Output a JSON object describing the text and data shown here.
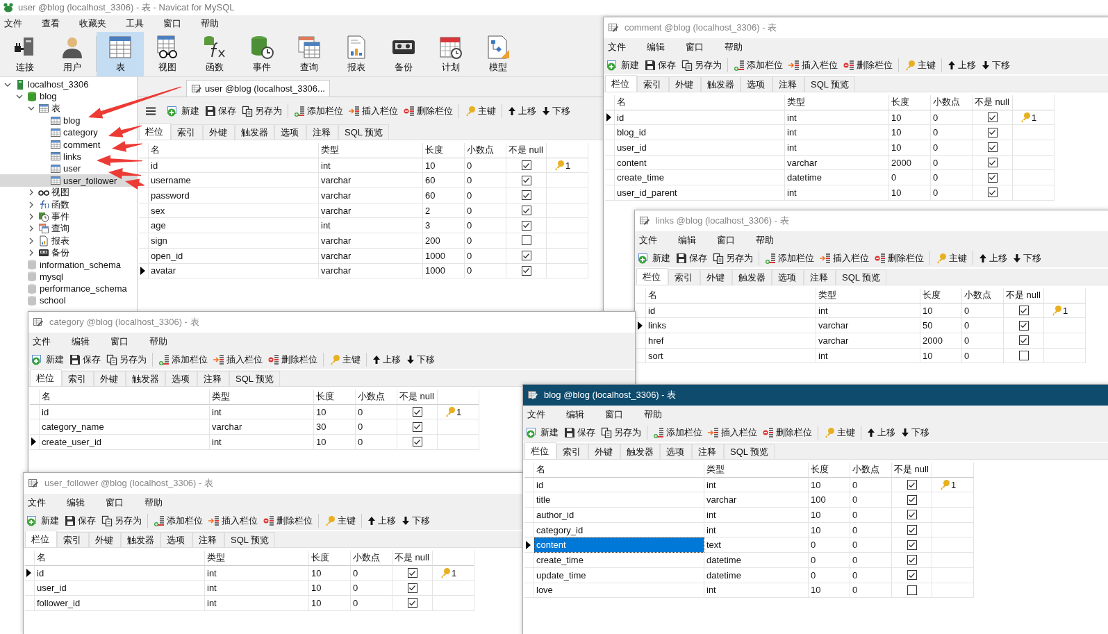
{
  "main": {
    "title": "user @blog (localhost_3306) - 表 - Navicat for MySQL",
    "menu": [
      "文件",
      "查看",
      "收藏夹",
      "工具",
      "窗口",
      "帮助"
    ],
    "ribbon": [
      {
        "kind": "connect",
        "label": "连接",
        "selected": false
      },
      {
        "kind": "user",
        "label": "用户",
        "selected": false
      },
      {
        "kind": "table",
        "label": "表",
        "selected": true
      },
      {
        "kind": "view",
        "label": "视图",
        "selected": false
      },
      {
        "kind": "function",
        "label": "函数",
        "selected": false
      },
      {
        "kind": "event",
        "label": "事件",
        "selected": false
      },
      {
        "kind": "query",
        "label": "查询",
        "selected": false
      },
      {
        "kind": "report",
        "label": "报表",
        "selected": false
      },
      {
        "kind": "backup",
        "label": "备份",
        "selected": false
      },
      {
        "kind": "schedule",
        "label": "计划",
        "selected": false
      },
      {
        "kind": "model",
        "label": "模型",
        "selected": false
      }
    ],
    "tree": [
      {
        "kind": "server",
        "label": "localhost_3306",
        "expanded": true,
        "selected": false,
        "children": [
          {
            "kind": "database",
            "label": "blog",
            "expanded": true,
            "selected": false,
            "children": [
              {
                "kind": "tables",
                "label": "表",
                "expanded": true,
                "selected": false,
                "children": [
                  {
                    "kind": "table",
                    "label": "blog",
                    "selected": false
                  },
                  {
                    "kind": "table",
                    "label": "category",
                    "selected": false
                  },
                  {
                    "kind": "table",
                    "label": "comment",
                    "selected": false
                  },
                  {
                    "kind": "table",
                    "label": "links",
                    "selected": false
                  },
                  {
                    "kind": "table",
                    "label": "user",
                    "selected": false
                  },
                  {
                    "kind": "table",
                    "label": "user_follower",
                    "selected": true
                  }
                ]
              },
              {
                "kind": "view",
                "label": "视图",
                "expanded": false,
                "selected": false
              },
              {
                "kind": "function",
                "label": "函数",
                "expanded": false,
                "selected": false
              },
              {
                "kind": "event",
                "label": "事件",
                "expanded": false,
                "selected": false
              },
              {
                "kind": "query",
                "label": "查询",
                "expanded": false,
                "selected": false
              },
              {
                "kind": "report",
                "label": "报表",
                "expanded": false,
                "selected": false
              },
              {
                "kind": "backup",
                "label": "备份",
                "expanded": false,
                "selected": false
              }
            ]
          },
          {
            "kind": "database-closed",
            "label": "information_schema",
            "selected": false
          },
          {
            "kind": "database-closed",
            "label": "mysql",
            "selected": false
          },
          {
            "kind": "database-closed",
            "label": "performance_schema",
            "selected": false
          },
          {
            "kind": "database-closed",
            "label": "school",
            "selected": false
          }
        ]
      }
    ],
    "doc_tab": "user @blog (localhost_3306..."
  },
  "windows": [
    {
      "toolbar": [
        {
          "kind": "new",
          "label": "新建"
        },
        {
          "kind": "save",
          "label": "保存"
        },
        {
          "kind": "saveas",
          "label": "另存为"
        },
        {
          "kind": "addcol",
          "label": "添加栏位"
        },
        {
          "kind": "insertcol",
          "label": "插入栏位"
        },
        {
          "kind": "delcol",
          "label": "删除栏位"
        },
        {
          "kind": "key",
          "label": "主键"
        },
        {
          "kind": "up",
          "label": "上移"
        },
        {
          "kind": "down",
          "label": "下移"
        }
      ],
      "tabs": [
        {
          "label": "栏位",
          "selected": true
        },
        {
          "label": "索引",
          "selected": false
        },
        {
          "label": "外键",
          "selected": false
        },
        {
          "label": "触发器",
          "selected": false
        },
        {
          "label": "选项",
          "selected": false
        },
        {
          "label": "注释",
          "selected": false
        },
        {
          "label": "SQL 预览",
          "selected": false
        }
      ],
      "columns": [
        "名",
        "类型",
        "长度",
        "小数点",
        "不是 null"
      ],
      "rows": [
        {
          "name": "id",
          "type": "int",
          "length": "10",
          "decimals": "0",
          "not_null": true,
          "key": "1",
          "current": false,
          "selected": false
        },
        {
          "name": "username",
          "type": "varchar",
          "length": "60",
          "decimals": "0",
          "not_null": true,
          "current": false,
          "selected": false
        },
        {
          "name": "password",
          "type": "varchar",
          "length": "60",
          "decimals": "0",
          "not_null": true,
          "current": false,
          "selected": false
        },
        {
          "name": "sex",
          "type": "varchar",
          "length": "2",
          "decimals": "0",
          "not_null": true,
          "current": false,
          "selected": false
        },
        {
          "name": "age",
          "type": "int",
          "length": "3",
          "decimals": "0",
          "not_null": true,
          "current": false,
          "selected": false
        },
        {
          "name": "sign",
          "type": "varchar",
          "length": "200",
          "decimals": "0",
          "not_null": false,
          "current": false,
          "selected": false
        },
        {
          "name": "open_id",
          "type": "varchar",
          "length": "1000",
          "decimals": "0",
          "not_null": true,
          "current": false,
          "selected": false
        },
        {
          "name": "avatar",
          "type": "varchar",
          "length": "1000",
          "decimals": "0",
          "not_null": true,
          "current": true,
          "selected": false
        }
      ]
    },
    {
      "active": false,
      "title": "comment @blog (localhost_3306) - 表",
      "menu": [
        "文件",
        "编辑",
        "窗口",
        "帮助"
      ],
      "toolbar": [
        {
          "kind": "new",
          "label": "新建"
        },
        {
          "kind": "save",
          "label": "保存"
        },
        {
          "kind": "saveas",
          "label": "另存为"
        },
        {
          "kind": "addcol",
          "label": "添加栏位"
        },
        {
          "kind": "insertcol",
          "label": "插入栏位"
        },
        {
          "kind": "delcol",
          "label": "删除栏位"
        },
        {
          "kind": "key",
          "label": "主键"
        },
        {
          "kind": "up",
          "label": "上移"
        },
        {
          "kind": "down",
          "label": "下移"
        }
      ],
      "tabs": [
        {
          "label": "栏位",
          "selected": true
        },
        {
          "label": "索引",
          "selected": false
        },
        {
          "label": "外键",
          "selected": false
        },
        {
          "label": "触发器",
          "selected": false
        },
        {
          "label": "选项",
          "selected": false
        },
        {
          "label": "注释",
          "selected": false
        },
        {
          "label": "SQL 预览",
          "selected": false
        }
      ],
      "columns": [
        "名",
        "类型",
        "长度",
        "小数点",
        "不是 null"
      ],
      "rows": [
        {
          "name": "id",
          "type": "int",
          "length": "10",
          "decimals": "0",
          "not_null": true,
          "key": "1",
          "current": true,
          "selected": false
        },
        {
          "name": "blog_id",
          "type": "int",
          "length": "10",
          "decimals": "0",
          "not_null": true,
          "current": false,
          "selected": false
        },
        {
          "name": "user_id",
          "type": "int",
          "length": "10",
          "decimals": "0",
          "not_null": true,
          "current": false,
          "selected": false
        },
        {
          "name": "content",
          "type": "varchar",
          "length": "2000",
          "decimals": "0",
          "not_null": true,
          "current": false,
          "selected": false
        },
        {
          "name": "create_time",
          "type": "datetime",
          "length": "0",
          "decimals": "0",
          "not_null": true,
          "current": false,
          "selected": false
        },
        {
          "name": "user_id_parent",
          "type": "int",
          "length": "10",
          "decimals": "0",
          "not_null": true,
          "current": false,
          "selected": false
        }
      ]
    },
    {
      "active": false,
      "title": "links @blog (localhost_3306) - 表",
      "menu": [
        "文件",
        "编辑",
        "窗口",
        "帮助"
      ],
      "toolbar": [
        {
          "kind": "new",
          "label": "新建"
        },
        {
          "kind": "save",
          "label": "保存"
        },
        {
          "kind": "saveas",
          "label": "另存为"
        },
        {
          "kind": "addcol",
          "label": "添加栏位"
        },
        {
          "kind": "insertcol",
          "label": "插入栏位"
        },
        {
          "kind": "delcol",
          "label": "删除栏位"
        },
        {
          "kind": "key",
          "label": "主键"
        },
        {
          "kind": "up",
          "label": "上移"
        },
        {
          "kind": "down",
          "label": "下移"
        }
      ],
      "tabs": [
        {
          "label": "栏位",
          "selected": true
        },
        {
          "label": "索引",
          "selected": false
        },
        {
          "label": "外键",
          "selected": false
        },
        {
          "label": "触发器",
          "selected": false
        },
        {
          "label": "选项",
          "selected": false
        },
        {
          "label": "注释",
          "selected": false
        },
        {
          "label": "SQL 预览",
          "selected": false
        }
      ],
      "columns": [
        "名",
        "类型",
        "长度",
        "小数点",
        "不是 null"
      ],
      "rows": [
        {
          "name": "id",
          "type": "int",
          "length": "10",
          "decimals": "0",
          "not_null": true,
          "key": "1",
          "current": false,
          "selected": false
        },
        {
          "name": "links",
          "type": "varchar",
          "length": "50",
          "decimals": "0",
          "not_null": true,
          "current": true,
          "selected": false
        },
        {
          "name": "href",
          "type": "varchar",
          "length": "2000",
          "decimals": "0",
          "not_null": true,
          "current": false,
          "selected": false
        },
        {
          "name": "sort",
          "type": "int",
          "length": "10",
          "decimals": "0",
          "not_null": false,
          "current": false,
          "selected": false
        }
      ]
    },
    {
      "active": false,
      "title": "category @blog (localhost_3306) - 表",
      "menu": [
        "文件",
        "编辑",
        "窗口",
        "帮助"
      ],
      "toolbar": [
        {
          "kind": "new",
          "label": "新建"
        },
        {
          "kind": "save",
          "label": "保存"
        },
        {
          "kind": "saveas",
          "label": "另存为"
        },
        {
          "kind": "addcol",
          "label": "添加栏位"
        },
        {
          "kind": "insertcol",
          "label": "插入栏位"
        },
        {
          "kind": "delcol",
          "label": "删除栏位"
        },
        {
          "kind": "key",
          "label": "主键"
        },
        {
          "kind": "up",
          "label": "上移"
        },
        {
          "kind": "down",
          "label": "下移"
        }
      ],
      "tabs": [
        {
          "label": "栏位",
          "selected": true
        },
        {
          "label": "索引",
          "selected": false
        },
        {
          "label": "外键",
          "selected": false
        },
        {
          "label": "触发器",
          "selected": false
        },
        {
          "label": "选项",
          "selected": false
        },
        {
          "label": "注释",
          "selected": false
        },
        {
          "label": "SQL 预览",
          "selected": false
        }
      ],
      "columns": [
        "名",
        "类型",
        "长度",
        "小数点",
        "不是 null"
      ],
      "rows": [
        {
          "name": "id",
          "type": "int",
          "length": "10",
          "decimals": "0",
          "not_null": true,
          "key": "1",
          "current": false,
          "selected": false
        },
        {
          "name": "category_name",
          "type": "varchar",
          "length": "30",
          "decimals": "0",
          "not_null": true,
          "current": false,
          "selected": false
        },
        {
          "name": "create_user_id",
          "type": "int",
          "length": "10",
          "decimals": "0",
          "not_null": true,
          "current": true,
          "selected": false
        }
      ]
    },
    {
      "active": false,
      "title": "user_follower @blog (localhost_3306) - 表",
      "menu": [
        "文件",
        "编辑",
        "窗口",
        "帮助"
      ],
      "toolbar": [
        {
          "kind": "new",
          "label": "新建"
        },
        {
          "kind": "save",
          "label": "保存"
        },
        {
          "kind": "saveas",
          "label": "另存为"
        },
        {
          "kind": "addcol",
          "label": "添加栏位"
        },
        {
          "kind": "insertcol",
          "label": "插入栏位"
        },
        {
          "kind": "delcol",
          "label": "删除栏位"
        },
        {
          "kind": "key",
          "label": "主键"
        },
        {
          "kind": "up",
          "label": "上移"
        },
        {
          "kind": "down",
          "label": "下移"
        }
      ],
      "tabs": [
        {
          "label": "栏位",
          "selected": true
        },
        {
          "label": "索引",
          "selected": false
        },
        {
          "label": "外键",
          "selected": false
        },
        {
          "label": "触发器",
          "selected": false
        },
        {
          "label": "选项",
          "selected": false
        },
        {
          "label": "注释",
          "selected": false
        },
        {
          "label": "SQL 预览",
          "selected": false
        }
      ],
      "columns": [
        "名",
        "类型",
        "长度",
        "小数点",
        "不是 null"
      ],
      "rows": [
        {
          "name": "id",
          "type": "int",
          "length": "10",
          "decimals": "0",
          "not_null": true,
          "key": "1",
          "current": true,
          "selected": false
        },
        {
          "name": "user_id",
          "type": "int",
          "length": "10",
          "decimals": "0",
          "not_null": true,
          "current": false,
          "selected": false
        },
        {
          "name": "follower_id",
          "type": "int",
          "length": "10",
          "decimals": "0",
          "not_null": true,
          "current": false,
          "selected": false
        }
      ]
    },
    {
      "active": true,
      "title": "blog @blog (localhost_3306) - 表",
      "menu": [
        "文件",
        "编辑",
        "窗口",
        "帮助"
      ],
      "toolbar": [
        {
          "kind": "new",
          "label": "新建"
        },
        {
          "kind": "save",
          "label": "保存"
        },
        {
          "kind": "saveas",
          "label": "另存为"
        },
        {
          "kind": "addcol",
          "label": "添加栏位"
        },
        {
          "kind": "insertcol",
          "label": "插入栏位"
        },
        {
          "kind": "delcol",
          "label": "删除栏位"
        },
        {
          "kind": "key",
          "label": "主键"
        },
        {
          "kind": "up",
          "label": "上移"
        },
        {
          "kind": "down",
          "label": "下移"
        }
      ],
      "tabs": [
        {
          "label": "栏位",
          "selected": true
        },
        {
          "label": "索引",
          "selected": false
        },
        {
          "label": "外键",
          "selected": false
        },
        {
          "label": "触发器",
          "selected": false
        },
        {
          "label": "选项",
          "selected": false
        },
        {
          "label": "注释",
          "selected": false
        },
        {
          "label": "SQL 预览",
          "selected": false
        }
      ],
      "columns": [
        "名",
        "类型",
        "长度",
        "小数点",
        "不是 null"
      ],
      "rows": [
        {
          "name": "id",
          "type": "int",
          "length": "10",
          "decimals": "0",
          "not_null": true,
          "key": "1",
          "current": false,
          "selected": false
        },
        {
          "name": "title",
          "type": "varchar",
          "length": "100",
          "decimals": "0",
          "not_null": true,
          "current": false,
          "selected": false
        },
        {
          "name": "author_id",
          "type": "int",
          "length": "10",
          "decimals": "0",
          "not_null": true,
          "current": false,
          "selected": false
        },
        {
          "name": "category_id",
          "type": "int",
          "length": "10",
          "decimals": "0",
          "not_null": true,
          "current": false,
          "selected": false
        },
        {
          "name": "content",
          "type": "text",
          "length": "0",
          "decimals": "0",
          "not_null": true,
          "current": true,
          "selected": true
        },
        {
          "name": "create_time",
          "type": "datetime",
          "length": "0",
          "decimals": "0",
          "not_null": true,
          "current": false,
          "selected": false
        },
        {
          "name": "update_time",
          "type": "datetime",
          "length": "0",
          "decimals": "0",
          "not_null": true,
          "current": false,
          "selected": false
        },
        {
          "name": "love",
          "type": "int",
          "length": "10",
          "decimals": "0",
          "not_null": false,
          "current": false,
          "selected": false
        }
      ]
    }
  ]
}
